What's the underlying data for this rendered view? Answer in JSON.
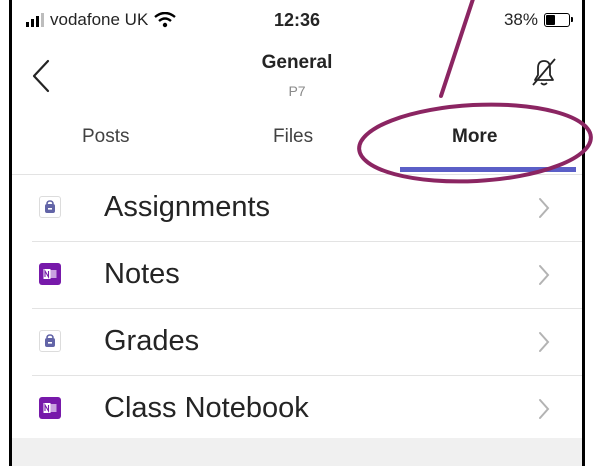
{
  "status_bar": {
    "carrier": "vodafone UK",
    "time": "12:36",
    "battery": "38%",
    "battery_level": 0.38
  },
  "header": {
    "title": "General",
    "subtitle": "P7"
  },
  "tabs": [
    {
      "label": "Posts",
      "active": false
    },
    {
      "label": "Files",
      "active": false
    },
    {
      "label": "More",
      "active": true
    }
  ],
  "items": [
    {
      "label": "Assignments",
      "icon": "assignments-bag-icon"
    },
    {
      "label": "Notes",
      "icon": "onenote-icon"
    },
    {
      "label": "Grades",
      "icon": "assignments-bag-icon"
    },
    {
      "label": "Class Notebook",
      "icon": "onenote-icon"
    }
  ],
  "colors": {
    "accent": "#5b5fc7",
    "onenote": "#7719aa",
    "annotation": "#8b2562"
  }
}
